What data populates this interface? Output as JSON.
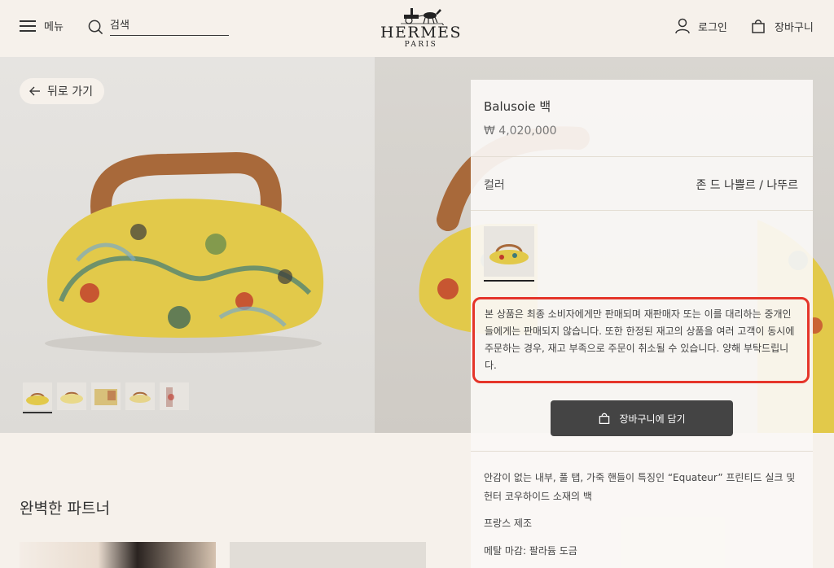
{
  "header": {
    "menu_label": "메뉴",
    "search_value": "검색",
    "brand": "HERMÈS",
    "brand_sub": "PARIS",
    "login_label": "로그인",
    "cart_label": "장바구니"
  },
  "gallery": {
    "back_label": "뒤로 가기",
    "thumbnail_count": 5,
    "active_thumbnail": 1
  },
  "product": {
    "title": "Balusoie 백",
    "price": "₩ 4,020,000",
    "color_label": "컬러",
    "color_value": "존 드 나쁠르 / 나뚜르",
    "notice": "본 상품은 최종 소비자에게만 판매되며 재판매자 또는 이를 대리하는 중개인들에게는 판매되지 않습니다. 또한 한정된 재고의 상품을 여러 고객이 동시에 주문하는 경우, 재고 부족으로 주문이 취소될 수 있습니다. 양해 부탁드립니다.",
    "add_to_cart_label": "장바구니에 담기",
    "description": "안감이 없는 내부, 풀 탭, 가죽 핸들이 특징인 “Equateur” 프린티드 실크 및 헌터 코우하이드 소재의 백",
    "made_in": "프랑스 제조",
    "hardware": "메탈 마감: 팔라듐 도금"
  },
  "section": {
    "title": "완벽한 파트너"
  },
  "colors": {
    "background": "#f6f1eb",
    "notice_border": "#e5352a",
    "button": "#444444",
    "bag_yellow": "#e2c94a",
    "handle_brown": "#a8693a"
  },
  "icons": [
    "hamburger-icon",
    "search-icon",
    "hermes-logo-icon",
    "user-icon",
    "shopping-bag-icon",
    "arrow-left-icon"
  ]
}
